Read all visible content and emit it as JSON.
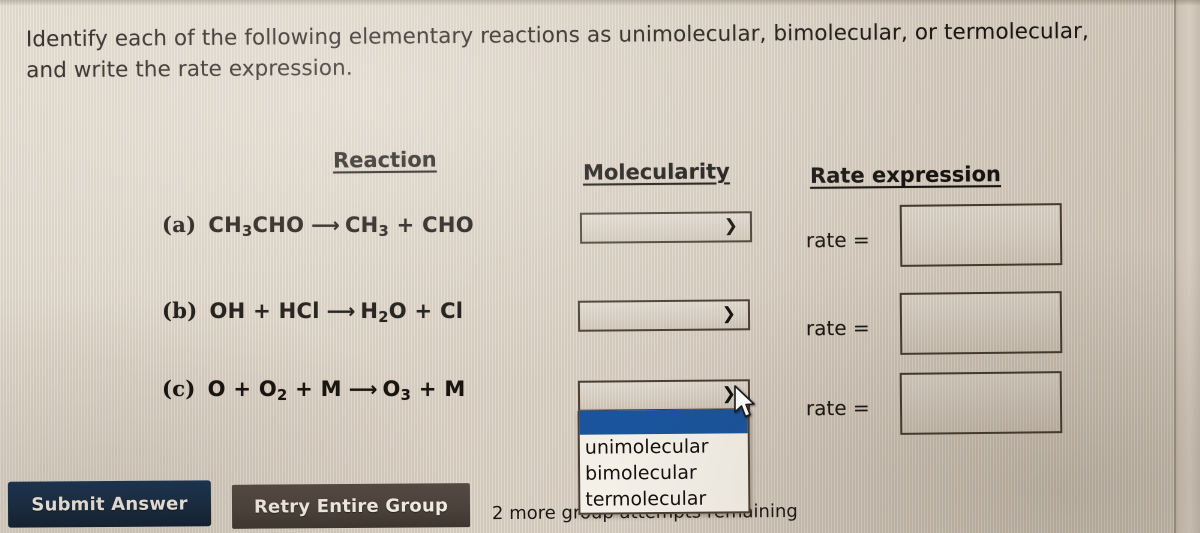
{
  "prompt": {
    "text": "Identify each of the following elementary reactions as unimolecular, bimolecular, or termolecular, and write the rate expression."
  },
  "table": {
    "headers": {
      "reaction": "Reaction",
      "molecularity": "Molecularity",
      "rate_expression": "Rate expression"
    },
    "rows": [
      {
        "label": "(a)",
        "reactants": "CH3CHO",
        "arrow": "⟶",
        "products": "CH3 + CHO",
        "molecularity_value": "",
        "rate_label": "rate =",
        "rate_value": ""
      },
      {
        "label": "(b)",
        "reactants": "OH + HCl",
        "arrow": "⟶",
        "products": "H2O + Cl",
        "molecularity_value": "",
        "rate_label": "rate =",
        "rate_value": ""
      },
      {
        "label": "(c)",
        "reactants": "O + O2 + M",
        "arrow": "⟶",
        "products": "O3 + M",
        "molecularity_value": "",
        "rate_label": "rate =",
        "rate_value": ""
      }
    ]
  },
  "dropdown": {
    "open": true,
    "selected_value": "",
    "options": [
      "",
      "unimolecular",
      "bimolecular",
      "termolecular"
    ],
    "visible_options": [
      "unimolecular",
      "bimolecular",
      "termolecular"
    ],
    "highlight_color": "#1a549c"
  },
  "footer": {
    "submit_label": "Submit Answer",
    "retry_label": "Retry Entire Group",
    "attempts_text": "2 more group attempts remaining",
    "submit_color": "#14293f",
    "retry_color": "#4a413b"
  },
  "icons": {
    "chevron": "⌄",
    "chevron_glyph": "❯"
  }
}
